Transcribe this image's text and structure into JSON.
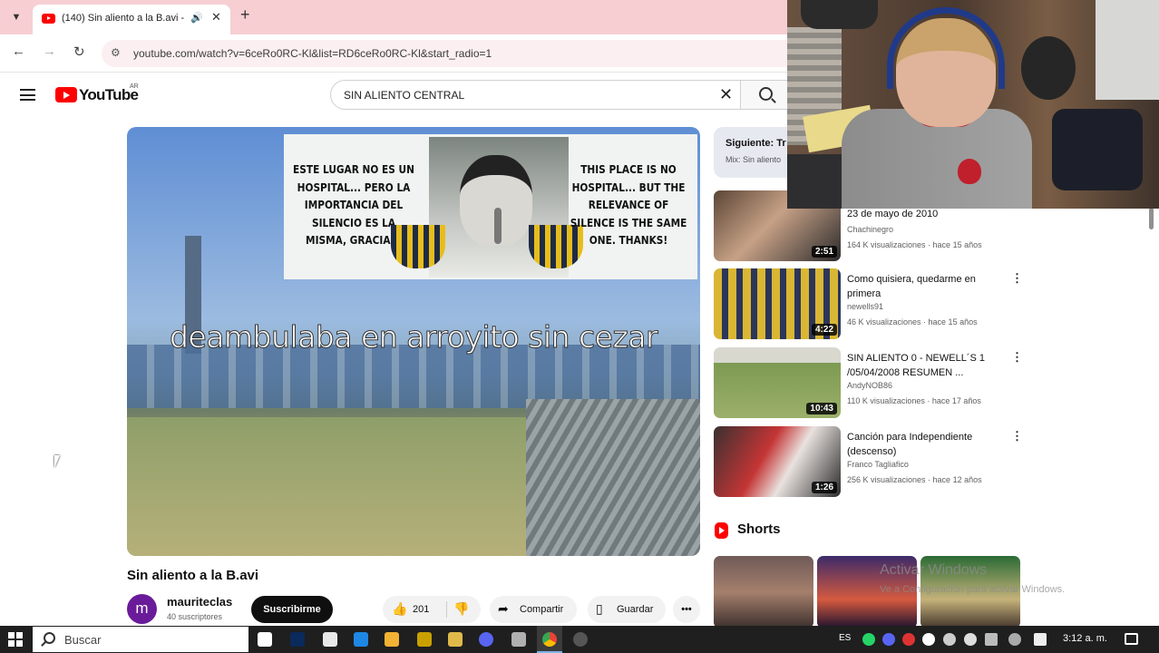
{
  "browser": {
    "tab_list_icon": "chevron-down-icon",
    "tab_title": "(140) Sin aliento a la B.avi -",
    "tab_audio_icon": "speaker-icon",
    "tab_close": "✕",
    "new_tab": "+",
    "url": "youtube.com/watch?v=6ceRo0RC-Kl&list=RD6ceRo0RC-Kl&start_radio=1"
  },
  "youtube": {
    "logo_text": "YouTube",
    "country_code": "AR",
    "search_value": "SIN ALIENTO CENTRAL",
    "search_clear": "✕"
  },
  "video": {
    "sign_left": "Este lugar no es un hospital... Pero la importancia del silencio es la misma, gracias!",
    "sign_right": "This place is no hospital... But the relevance of silence is the same one. Thanks!",
    "lyric": "deambulaba en arroyito sin cezar",
    "title": "Sin aliento a la B.avi",
    "channel_initial": "m",
    "channel_name": "mauriteclas",
    "channel_subs": "40 suscriptores",
    "subscribe_label": "Suscribirme",
    "like_count": "201",
    "share_label": "Compartir",
    "save_label": "Guardar",
    "more_label": "•••"
  },
  "up_next": {
    "title": "Siguiente: Tr",
    "subtitle": "Mix: Sin aliento"
  },
  "recommendations": [
    {
      "title": "23 de mayo de 2010",
      "channel": "Chachinegro",
      "stats": "164 K visualizaciones · hace 15 años",
      "duration": "2:51"
    },
    {
      "title": "Como quisiera, quedarme en primera",
      "channel": "newells91",
      "stats": "46 K visualizaciones · hace 15 años",
      "duration": "4:22"
    },
    {
      "title": "SIN ALIENTO 0 - NEWELL´S 1 /05/04/2008 RESUMEN ...",
      "channel": "AndyNOB86",
      "stats": "110 K visualizaciones · hace 17 años",
      "duration": "10:43"
    },
    {
      "title": "Canción para Independiente (descenso)",
      "channel": "Franco Tagliafico",
      "stats": "256 K visualizaciones · hace 12 años",
      "duration": "1:26"
    }
  ],
  "shorts": {
    "label": "Shorts"
  },
  "activation": {
    "title": "Activar Windows",
    "subtitle": "Ve a Configuración para activar Windows."
  },
  "taskbar": {
    "search_placeholder": "Buscar",
    "language": "ES",
    "time": "3:12 a. m."
  },
  "colors": {
    "youtube_red": "#ff0000",
    "tab_strip": "#f7cfd3",
    "taskbar": "#1f1f1f",
    "subscribe_button": "#0f0f0f",
    "channel_avatar": "#6a1b9a"
  }
}
